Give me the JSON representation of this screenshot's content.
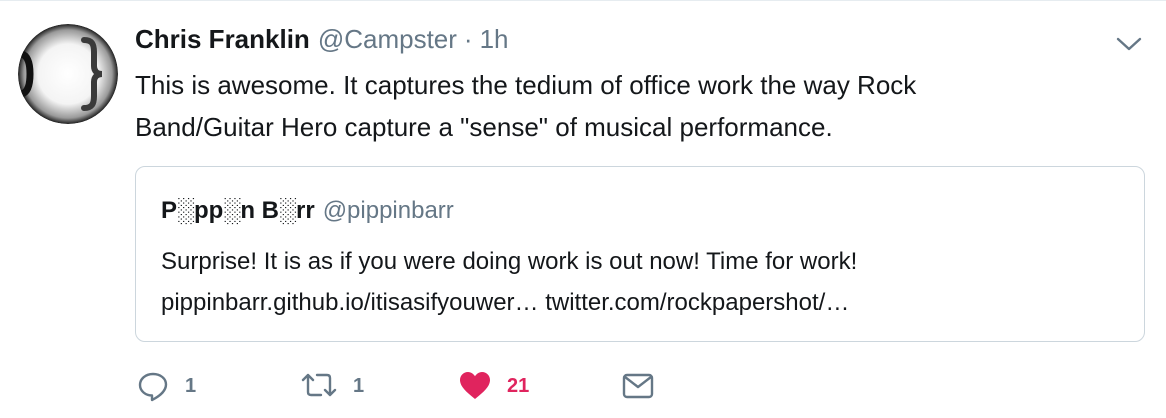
{
  "tweet": {
    "author": {
      "name": "Chris Franklin",
      "handle": "@Campster",
      "separator": "·",
      "time": "1h",
      "avatar_icon": "curly-brace-avatar"
    },
    "text_lines": [
      "This is awesome. It captures the tedium of office work the way Rock",
      "Band/Guitar Hero capture a \"sense\" of musical performance."
    ],
    "quoted": {
      "name": "P░pp░n B░rr",
      "handle": "@pippinbarr",
      "text_lines": [
        "Surprise! It is as if you were doing work is out now! Time for work!",
        "pippinbarr.github.io/itisasifyouwer… twitter.com/rockpapershot/…"
      ]
    },
    "actions": {
      "reply": {
        "icon": "reply-icon",
        "count": "1"
      },
      "retweet": {
        "icon": "retweet-icon",
        "count": "1"
      },
      "like": {
        "icon": "heart-icon",
        "count": "21",
        "color": "#e0245e"
      },
      "dm": {
        "icon": "envelope-icon"
      }
    },
    "menu_icon": "chevron-down-icon"
  }
}
